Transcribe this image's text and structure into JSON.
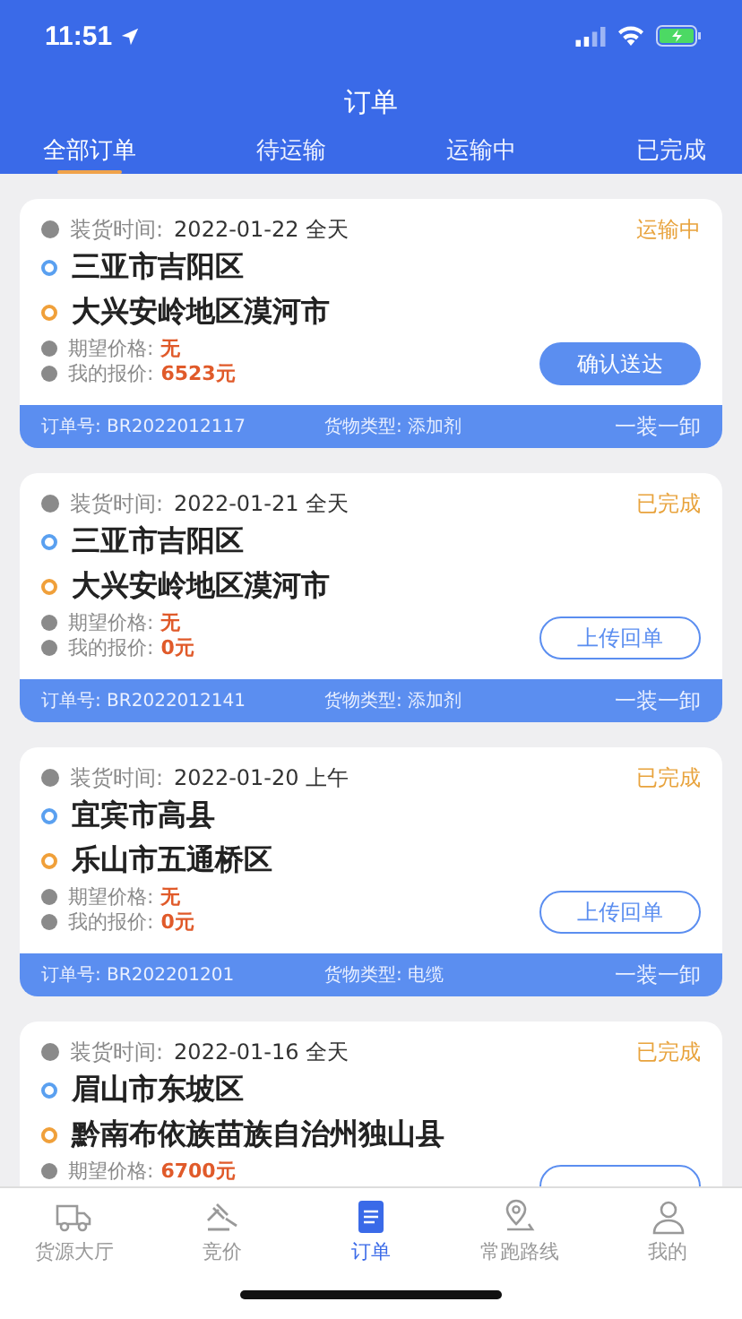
{
  "status_bar": {
    "time": "11:51"
  },
  "header": {
    "title": "订单"
  },
  "tabs": [
    {
      "label": "全部订单",
      "selected": true
    },
    {
      "label": "待运输",
      "selected": false
    },
    {
      "label": "运输中",
      "selected": false
    },
    {
      "label": "已完成",
      "selected": false
    }
  ],
  "orders": [
    {
      "time_label": "装货时间:",
      "time_value": "2022-01-22 全天",
      "status": "运输中",
      "origin": "三亚市吉阳区",
      "destination": "大兴安岭地区漠河市",
      "prices": [
        {
          "label": "期望价格:",
          "value": "无"
        },
        {
          "label": "我的报价:",
          "value": "6523元"
        }
      ],
      "button": {
        "kind": "filled",
        "label": "确认送达"
      },
      "order_no": "订单号: BR2022012117",
      "cargo": "货物类型: 添加剂",
      "mode": "一装一卸"
    },
    {
      "time_label": "装货时间:",
      "time_value": "2022-01-21 全天",
      "status": "已完成",
      "origin": "三亚市吉阳区",
      "destination": "大兴安岭地区漠河市",
      "prices": [
        {
          "label": "期望价格:",
          "value": "无"
        },
        {
          "label": "我的报价:",
          "value": "0元"
        }
      ],
      "button": {
        "kind": "outline",
        "label": "上传回单"
      },
      "order_no": "订单号: BR2022012141",
      "cargo": "货物类型: 添加剂",
      "mode": "一装一卸"
    },
    {
      "time_label": "装货时间:",
      "time_value": "2022-01-20 上午",
      "status": "已完成",
      "origin": "宜宾市高县",
      "destination": "乐山市五通桥区",
      "prices": [
        {
          "label": "期望价格:",
          "value": "无"
        },
        {
          "label": "我的报价:",
          "value": "0元"
        }
      ],
      "button": {
        "kind": "outline",
        "label": "上传回单"
      },
      "order_no": "订单号: BR202201201",
      "cargo": "货物类型: 电缆",
      "mode": "一装一卸"
    },
    {
      "time_label": "装货时间:",
      "time_value": "2022-01-16 全天",
      "status": "已完成",
      "origin": "眉山市东坡区",
      "destination": "黔南布依族苗族自治州独山县",
      "prices": [
        {
          "label": "期望价格:",
          "value": "6700元"
        }
      ],
      "button": {
        "kind": "outline"
      }
    }
  ],
  "bottom_nav": [
    {
      "label": "货源大厅",
      "selected": false
    },
    {
      "label": "竞价",
      "selected": false
    },
    {
      "label": "订单",
      "selected": true
    },
    {
      "label": "常跑路线",
      "selected": false
    },
    {
      "label": "我的",
      "selected": false
    }
  ]
}
